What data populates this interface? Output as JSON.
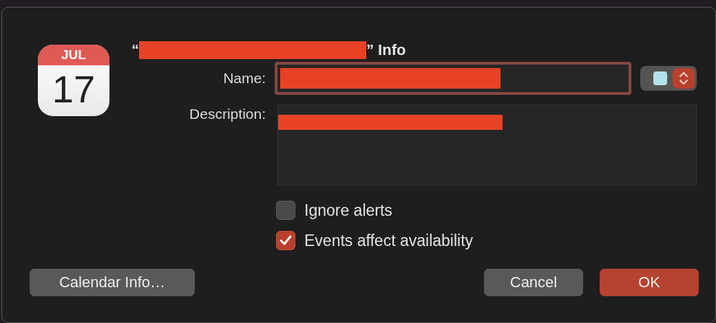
{
  "app_icon": {
    "month": "JUL",
    "day": "17"
  },
  "title": {
    "open_quote": "“",
    "redacted": true,
    "close_text": "” Info"
  },
  "name_field": {
    "label": "Name:",
    "redacted": true,
    "focused": true
  },
  "color_popup": {
    "color": "#b3e3e8"
  },
  "description_field": {
    "label": "Description:",
    "redacted": true
  },
  "checkboxes": [
    {
      "label": "Ignore alerts",
      "checked": false
    },
    {
      "label": "Events affect availability",
      "checked": true
    }
  ],
  "buttons": [
    {
      "label": "Calendar Info…",
      "kind": "plain"
    },
    {
      "label": "Cancel",
      "kind": "plain"
    },
    {
      "label": "OK",
      "kind": "default"
    }
  ]
}
